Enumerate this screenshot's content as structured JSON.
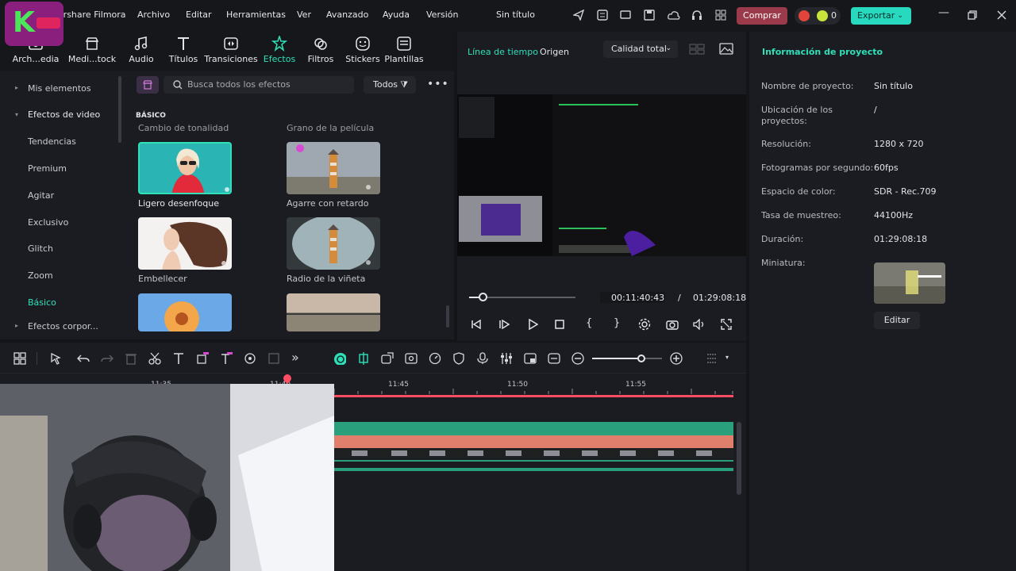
{
  "menubar": {
    "app_name": "Wondershare Filmora",
    "items": [
      "Archivo",
      "Editar",
      "Herramientas",
      "Ver",
      "Avanzado",
      "Ayuda",
      "Versión"
    ],
    "project_title": "Sin título",
    "buy_label": "Comprar",
    "credits": "0",
    "export_label": "Exportar"
  },
  "tabs": [
    {
      "label": "Arch...edia",
      "icon": "folder-icon"
    },
    {
      "label": "Medi...tock",
      "icon": "store-icon"
    },
    {
      "label": "Audio",
      "icon": "music-icon"
    },
    {
      "label": "Títulos",
      "icon": "text-icon"
    },
    {
      "label": "Transiciones",
      "icon": "transition-icon"
    },
    {
      "label": "Efectos",
      "icon": "effects-icon"
    },
    {
      "label": "Filtros",
      "icon": "filter-icon"
    },
    {
      "label": "Stickers",
      "icon": "sticker-icon"
    },
    {
      "label": "Plantillas",
      "icon": "template-icon"
    }
  ],
  "sidebar": {
    "items": [
      {
        "label": "Mis elementos"
      },
      {
        "label": "Efectos de video"
      },
      {
        "label": "Tendencias"
      },
      {
        "label": "Premium"
      },
      {
        "label": "Agitar"
      },
      {
        "label": "Exclusivo"
      },
      {
        "label": "Glitch"
      },
      {
        "label": "Zoom"
      },
      {
        "label": "Básico"
      },
      {
        "label": "Efectos corpor..."
      }
    ]
  },
  "effects": {
    "search_placeholder": "Busca todos los efectos",
    "filter_label": "Todos",
    "section": "BÁSICO",
    "partial_top_left": "Cambio de tonalidad",
    "partial_top_right": "Grano de la película",
    "items": [
      {
        "label": "Ligero desenfoque"
      },
      {
        "label": "Agarre con retardo"
      },
      {
        "label": "Embellecer"
      },
      {
        "label": "Radio de la viñeta"
      }
    ]
  },
  "player": {
    "tab_timeline": "Línea de tiempo",
    "tab_source": "Origen",
    "quality": "Calidad total",
    "current_time": "00:11:40:43",
    "separator": "/",
    "total_time": "01:29:08:18",
    "progress": 0.13
  },
  "info": {
    "title": "Información de proyecto",
    "rows": [
      {
        "key": "Nombre de proyecto:",
        "value": "Sin título"
      },
      {
        "key": "Ubicación de los proyectos:",
        "value": "/"
      },
      {
        "key": "Resolución:",
        "value": "1280 x 720"
      },
      {
        "key": "Fotogramas por segundo:",
        "value": "60fps"
      },
      {
        "key": "Espacio de color:",
        "value": "SDR - Rec.709"
      },
      {
        "key": "Tasa de muestreo:",
        "value": "44100Hz"
      },
      {
        "key": "Duración:",
        "value": "01:29:08:18"
      },
      {
        "key": "Miniatura:",
        "value": ""
      }
    ],
    "edit_label": "Editar"
  },
  "timeline": {
    "ruler": [
      "11:35",
      "11:40",
      "11:45",
      "11:50",
      "11:55"
    ],
    "zoom_level": 0.7
  },
  "colors": {
    "accent": "#2fe0b9",
    "buy": "#9b3a4a",
    "export": "#27d9bf",
    "playhead": "#ff4d63",
    "track_green": "#2a9f7c",
    "track_salmon": "#e07f6c"
  }
}
